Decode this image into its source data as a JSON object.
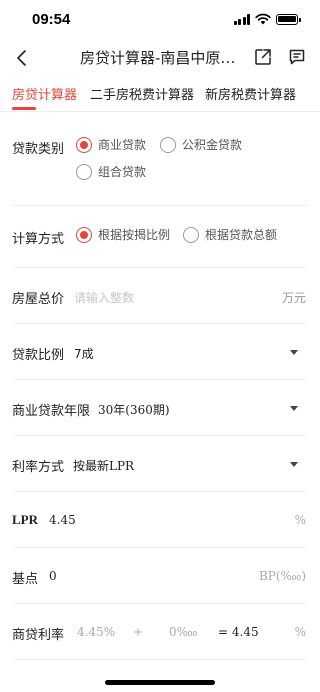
{
  "status": {
    "time": "09:54"
  },
  "nav": {
    "title": "房贷计算器-南昌中原…"
  },
  "tabs": [
    "房贷计算器",
    "二手房税费计算器",
    "新房税费计算器"
  ],
  "loan_type": {
    "label": "贷款类别",
    "options": [
      "商业贷款",
      "公积金贷款",
      "组合贷款"
    ],
    "selected": "商业贷款"
  },
  "calc_method": {
    "label": "计算方式",
    "options": [
      "根据按揭比例",
      "根据贷款总额"
    ],
    "selected": "根据按揭比例"
  },
  "house_price": {
    "label": "房屋总价",
    "placeholder": "请输入整数",
    "unit": "万元"
  },
  "loan_ratio": {
    "label": "贷款比例",
    "value": "7成"
  },
  "loan_term": {
    "label": "商业贷款年限",
    "value": "30年(360期)"
  },
  "rate_method": {
    "label": "利率方式",
    "value": "按最新LPR"
  },
  "lpr": {
    "label": "LPR",
    "value": "4.45",
    "unit": "%"
  },
  "basis_point": {
    "label": "基点",
    "value": "0",
    "unit": "BP(‱)"
  },
  "commercial_rate": {
    "label": "商贷利率",
    "lpr_value": "4.45%",
    "plus": "+",
    "bp_value": "0‱",
    "equals": "= 4.45",
    "unit": "%"
  }
}
